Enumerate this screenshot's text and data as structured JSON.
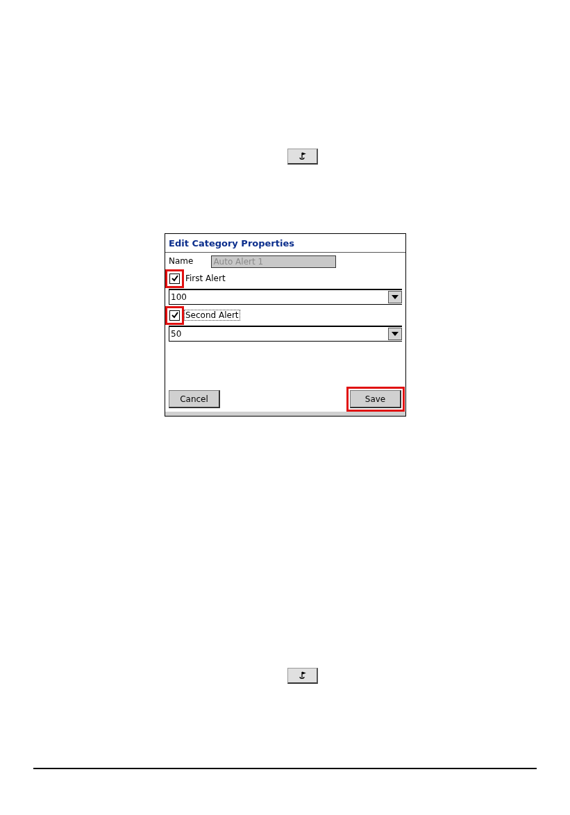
{
  "top_button": {
    "kind": "flag"
  },
  "dialog": {
    "title": "Edit Category Properties",
    "name_field": {
      "label": "Name",
      "value": "Auto Alert 1",
      "disabled": true
    },
    "alerts": [
      {
        "label": "First Alert",
        "checked": true,
        "highlighted": true,
        "focused": false,
        "value": "100"
      },
      {
        "label": "Second Alert",
        "checked": true,
        "highlighted": true,
        "focused": true,
        "value": "50"
      }
    ],
    "buttons": [
      {
        "label": "Cancel",
        "highlighted": false
      },
      {
        "label": "Save",
        "highlighted": true
      }
    ]
  },
  "bottom_button": {
    "kind": "flag"
  }
}
